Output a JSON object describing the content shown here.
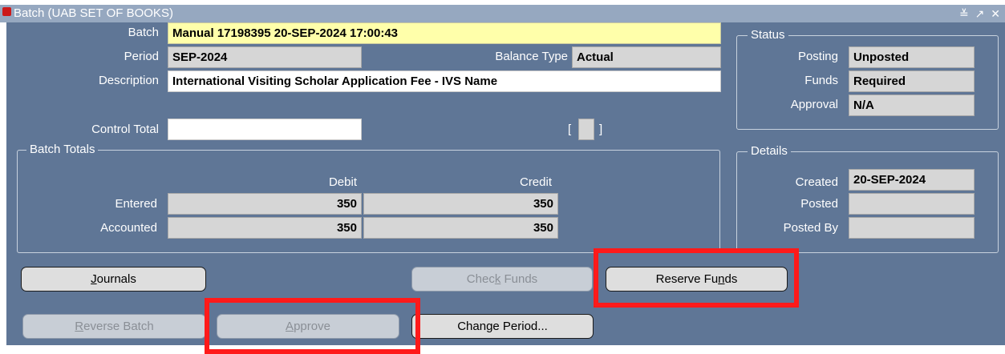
{
  "window": {
    "title": "Batch (UAB SET OF BOOKS)",
    "controls": "≚ ↗ ✕"
  },
  "batch": {
    "label": "Batch",
    "value": "Manual 17198395 20-SEP-2024 17:00:43"
  },
  "period": {
    "label": "Period",
    "value": "SEP-2024"
  },
  "balance_type": {
    "label": "Balance Type",
    "value": "Actual"
  },
  "description": {
    "label": "Description",
    "value": "International Visiting Scholar Application Fee - IVS Name"
  },
  "control_total": {
    "label": "Control Total",
    "value": "",
    "bracket_open": "[",
    "bracket_close": "]"
  },
  "status": {
    "title": "Status",
    "posting": {
      "label": "Posting",
      "value": "Unposted"
    },
    "funds": {
      "label": "Funds",
      "value": "Required"
    },
    "approval": {
      "label": "Approval",
      "value": "N/A"
    }
  },
  "batch_totals": {
    "title": "Batch Totals",
    "debit_header": "Debit",
    "credit_header": "Credit",
    "entered": {
      "label": "Entered",
      "debit": "350",
      "credit": "350"
    },
    "accounted": {
      "label": "Accounted",
      "debit": "350",
      "credit": "350"
    }
  },
  "details": {
    "title": "Details",
    "created": {
      "label": "Created",
      "value": "20-SEP-2024"
    },
    "posted": {
      "label": "Posted",
      "value": ""
    },
    "posted_by": {
      "label": "Posted By",
      "value": ""
    }
  },
  "buttons": {
    "journals": {
      "pre": "",
      "key": "J",
      "post": "ournals"
    },
    "check_funds": {
      "pre": "Chec",
      "key": "k",
      "post": " Funds"
    },
    "reserve_funds": {
      "pre": "Reserve Fu",
      "key": "n",
      "post": "ds"
    },
    "reverse_batch": {
      "pre": "",
      "key": "R",
      "post": "everse Batch"
    },
    "approve": {
      "pre": "",
      "key": "A",
      "post": "pprove"
    },
    "change_period": {
      "pre": "",
      "key": "",
      "post": "Change Period..."
    }
  },
  "colors": {
    "highlight": "#ff1a1a",
    "form_background": "#5f7696",
    "required_field": "#ffffaa"
  }
}
